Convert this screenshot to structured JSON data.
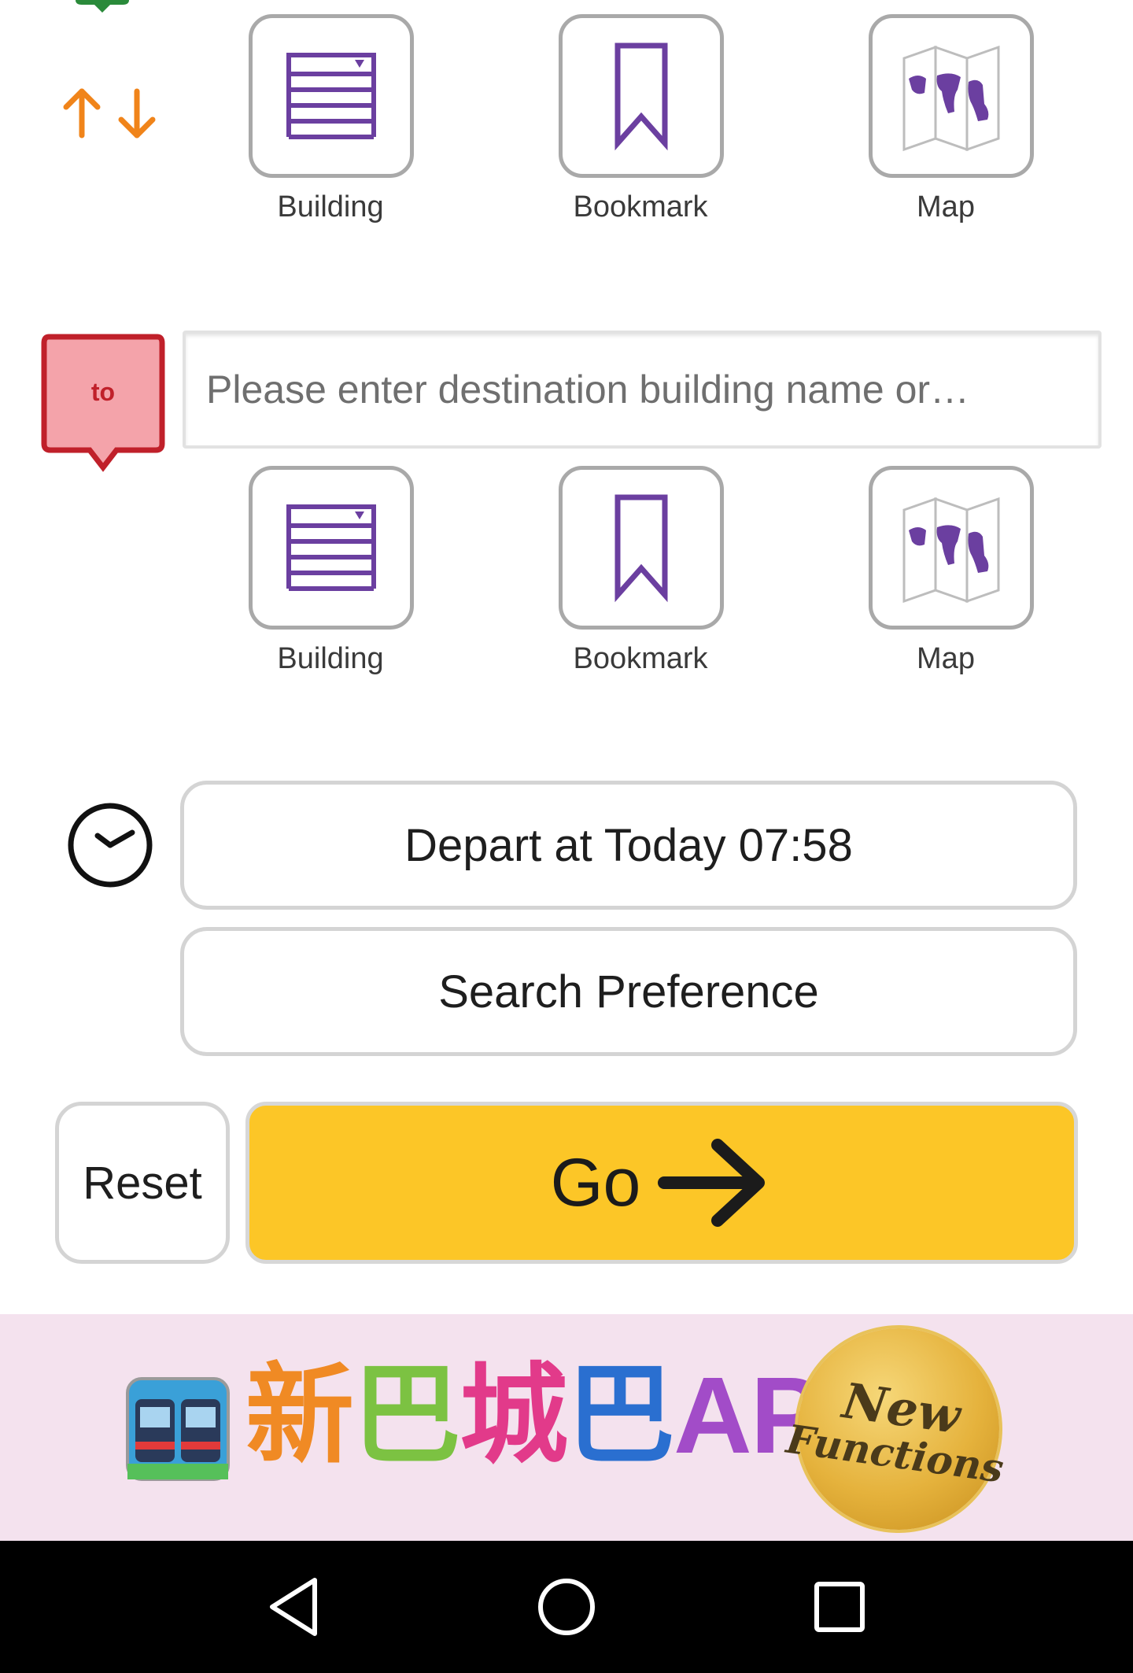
{
  "origin_tiles": [
    {
      "label": "Building",
      "icon": "building-list-icon"
    },
    {
      "label": "Bookmark",
      "icon": "bookmark-icon"
    },
    {
      "label": "Map",
      "icon": "map-icon"
    }
  ],
  "destination": {
    "marker_label": "to",
    "placeholder": "Please enter destination building name or…",
    "value": ""
  },
  "destination_tiles": [
    {
      "label": "Building",
      "icon": "building-list-icon"
    },
    {
      "label": "Bookmark",
      "icon": "bookmark-icon"
    },
    {
      "label": "Map",
      "icon": "map-icon"
    }
  ],
  "depart": {
    "label": "Depart at Today 07:58"
  },
  "search_preference": {
    "label": "Search Preference"
  },
  "actions": {
    "reset_label": "Reset",
    "go_label": "Go"
  },
  "banner": {
    "title_chars": [
      "新",
      "巴",
      "城",
      "巴",
      "APP"
    ],
    "badge_line1": "New",
    "badge_line2": "Functions"
  },
  "colors": {
    "accent_yellow": "#fcc627",
    "icon_purple": "#6b3fa0",
    "to_marker_red": "#c0202a",
    "to_marker_fill": "#f4a3aa",
    "swap_arrow_orange": "#f0841a",
    "origin_marker_green": "#2a8a3a"
  }
}
